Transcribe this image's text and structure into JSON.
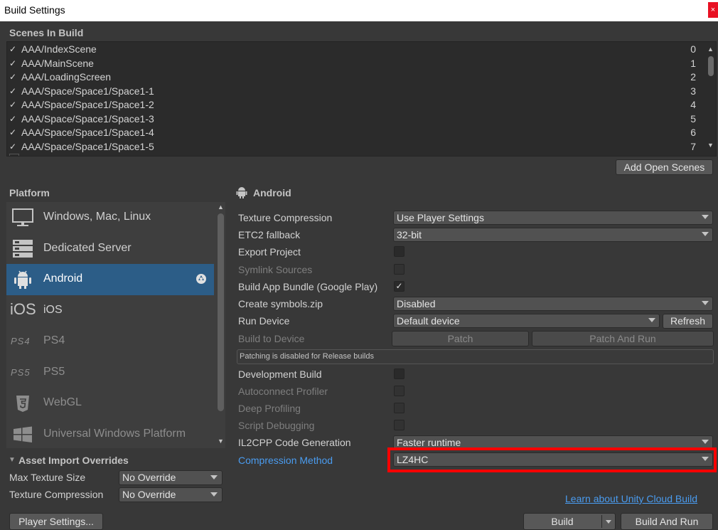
{
  "window": {
    "title": "Build Settings",
    "close_glyph": "×"
  },
  "scenes": {
    "title": "Scenes In Build",
    "items": [
      {
        "name": "AAA/IndexScene",
        "index": "0"
      },
      {
        "name": "AAA/MainScene",
        "index": "1"
      },
      {
        "name": "AAA/LoadingScreen",
        "index": "2"
      },
      {
        "name": "AAA/Space/Space1/Space1-1",
        "index": "3"
      },
      {
        "name": "AAA/Space/Space1/Space1-2",
        "index": "4"
      },
      {
        "name": "AAA/Space/Space1/Space1-3",
        "index": "5"
      },
      {
        "name": "AAA/Space/Space1/Space1-4",
        "index": "6"
      },
      {
        "name": "AAA/Space/Space1/Space1-5",
        "index": "7"
      }
    ],
    "add_open_scenes": "Add Open Scenes"
  },
  "platform": {
    "title": "Platform",
    "items": [
      {
        "label": "Windows, Mac, Linux",
        "icon": "monitor-icon"
      },
      {
        "label": "Dedicated Server",
        "icon": "server-icon"
      },
      {
        "label": "Android",
        "icon": "android-icon"
      },
      {
        "label": "iOS",
        "icon": "ios-icon"
      },
      {
        "label": "PS4",
        "icon": "ps4-icon"
      },
      {
        "label": "PS5",
        "icon": "ps5-icon"
      },
      {
        "label": "WebGL",
        "icon": "html5-icon"
      },
      {
        "label": "Universal Windows Platform",
        "icon": "windows-icon"
      }
    ],
    "ios_glyph": "iOS",
    "ps4_glyph": "PS4",
    "ps5_glyph": "PS5"
  },
  "asset_import": {
    "title": "Asset Import Overrides",
    "max_texture_label": "Max Texture Size",
    "max_texture_value": "No Override",
    "texture_compression_label": "Texture Compression",
    "texture_compression_value": "No Override"
  },
  "player_settings": "Player Settings...",
  "android": {
    "header": "Android",
    "texture_compression_label": "Texture Compression",
    "texture_compression_value": "Use Player Settings",
    "etc2_label": "ETC2 fallback",
    "etc2_value": "32-bit",
    "export_project_label": "Export Project",
    "symlink_label": "Symlink Sources",
    "app_bundle_label": "Build App Bundle (Google Play)",
    "symbols_label": "Create symbols.zip",
    "symbols_value": "Disabled",
    "run_device_label": "Run Device",
    "run_device_value": "Default device",
    "refresh": "Refresh",
    "build_to_device_label": "Build to Device",
    "patch": "Patch",
    "patch_and_run": "Patch And Run",
    "patching_note": "Patching is disabled for Release builds",
    "development_build_label": "Development Build",
    "autoconnect_label": "Autoconnect Profiler",
    "deep_profiling_label": "Deep Profiling",
    "script_debugging_label": "Script Debugging",
    "il2cpp_label": "IL2CPP Code Generation",
    "il2cpp_value": "Faster runtime",
    "compression_label": "Compression Method",
    "compression_value": "LZ4HC",
    "checkmark": "✓"
  },
  "cloud_build_link": "Learn about Unity Cloud Build",
  "build": "Build",
  "build_and_run": "Build And Run",
  "colors": {
    "selection": "#2c5d87",
    "highlight": "#ff0000",
    "link": "#4a9cf0"
  }
}
